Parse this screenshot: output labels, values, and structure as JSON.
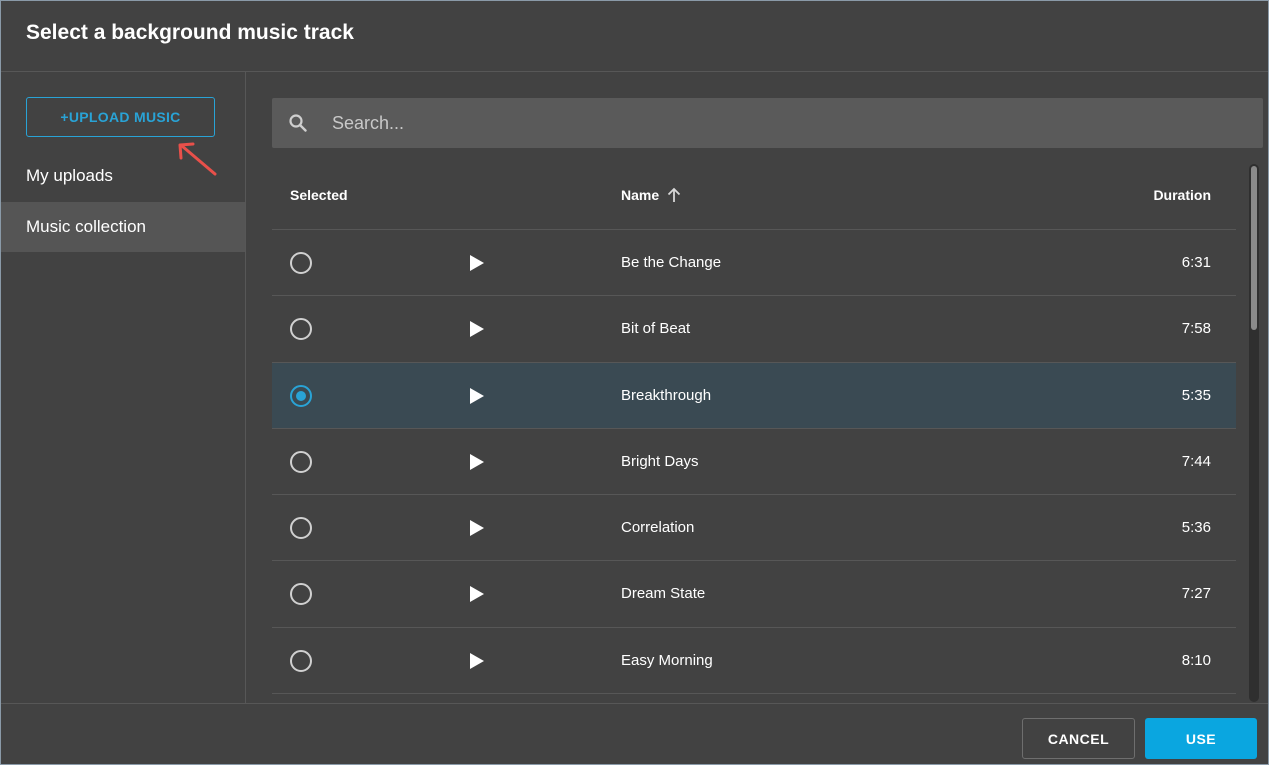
{
  "dialog": {
    "title": "Select a background music track"
  },
  "sidebar": {
    "upload_label": "+UPLOAD MUSIC",
    "items": [
      {
        "label": "My uploads",
        "active": false
      },
      {
        "label": "Music collection",
        "active": true
      }
    ]
  },
  "search": {
    "placeholder": "Search...",
    "value": ""
  },
  "table": {
    "columns": {
      "selected": "Selected",
      "name": "Name",
      "duration": "Duration"
    },
    "sort": {
      "column": "name",
      "direction": "ascending",
      "icon": "arrow-up-icon"
    },
    "rows": [
      {
        "name": "Be the Change",
        "duration": "6:31",
        "selected": false
      },
      {
        "name": "Bit of Beat",
        "duration": "7:58",
        "selected": false
      },
      {
        "name": "Breakthrough",
        "duration": "5:35",
        "selected": true
      },
      {
        "name": "Bright Days",
        "duration": "7:44",
        "selected": false
      },
      {
        "name": "Correlation",
        "duration": "5:36",
        "selected": false
      },
      {
        "name": "Dream State",
        "duration": "7:27",
        "selected": false
      },
      {
        "name": "Easy Morning",
        "duration": "8:10",
        "selected": false
      }
    ]
  },
  "footer": {
    "cancel_label": "CANCEL",
    "use_label": "USE"
  },
  "colors": {
    "background": "#424242",
    "accent": "#29a3d6",
    "primary_button": "#0aa6e0",
    "selected_row": "#3a4a53",
    "annotation_arrow": "#e8504a"
  }
}
